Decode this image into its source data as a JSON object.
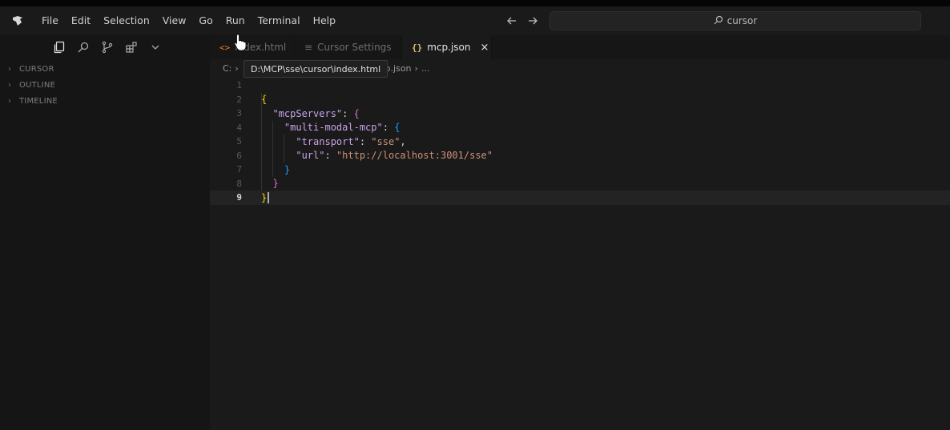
{
  "titlebar": {
    "logo_icon": "cursor-logo-icon",
    "menu": [
      "File",
      "Edit",
      "Selection",
      "View",
      "Go",
      "Run",
      "Terminal",
      "Help"
    ],
    "search_text": "cursor",
    "search_icon": "search-icon"
  },
  "sidebar": {
    "toolbar_icons": [
      "explorer-icon",
      "search-icon",
      "source-control-icon",
      "extensions-icon",
      "chevron-down-icon"
    ],
    "sections": [
      "CURSOR",
      "OUTLINE",
      "TIMELINE"
    ]
  },
  "tabs": [
    {
      "label": "index.html",
      "icon": "<>",
      "active": false
    },
    {
      "label": "Cursor Settings",
      "icon": "≡",
      "active": false
    },
    {
      "label": "mcp.json",
      "icon": "{}",
      "active": true
    }
  ],
  "breadcrumb": {
    "drive": "C:",
    "sep": "›",
    "file": "mcp.json",
    "tail": "...",
    "tooltip": "D:\\MCP\\sse\\cursor\\index.html"
  },
  "editor": {
    "line_numbers": [
      "1",
      "2",
      "3",
      "4",
      "5",
      "6",
      "7",
      "8",
      "9"
    ],
    "current_line": 9,
    "code": {
      "l2_open": "{",
      "l3_key": "\"mcpServers\"",
      "l3_rest": ": ",
      "l3_brace": "{",
      "l4_key": "\"multi-modal-mcp\"",
      "l4_rest": ": ",
      "l4_brace": "{",
      "l5_key": "\"transport\"",
      "l5_colon": ": ",
      "l5_val": "\"sse\"",
      "l5_comma": ",",
      "l6_key": "\"url\"",
      "l6_colon": ": ",
      "l6_val": "\"http://localhost:3001/sse\"",
      "l7_close": "}",
      "l8_close": "}",
      "l9_close": "}"
    }
  }
}
